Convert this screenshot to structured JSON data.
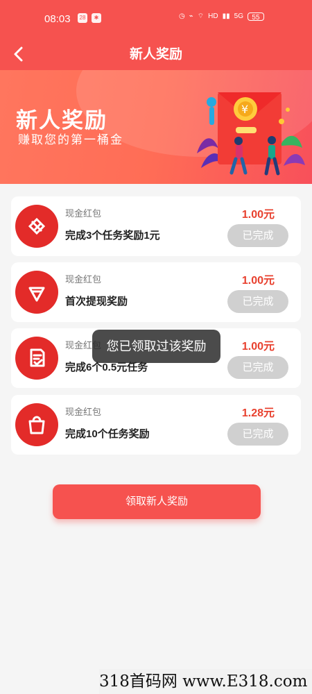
{
  "status_bar": {
    "time": "08:03",
    "left_icons": [
      "calendar-icon",
      "settings-icon"
    ],
    "calendar_text": "28",
    "right_icons": [
      "alarm-icon",
      "mute-icon",
      "wifi-icon",
      "hd-icon",
      "signal-icon",
      "5g-signal-icon"
    ],
    "hd_text": "HD",
    "battery": "55"
  },
  "header": {
    "title": "新人奖励",
    "back_icon": "back-icon"
  },
  "banner": {
    "title": "新人奖励",
    "subtitle": "赚取您的第一桶金"
  },
  "rewards": [
    {
      "category": "现金红包",
      "description": "完成3个任务奖励1元",
      "amount": "1.00元",
      "status": "已完成",
      "icon": "coupon-icon"
    },
    {
      "category": "现金红包",
      "description": "首次提现奖励",
      "amount": "1.00元",
      "status": "已完成",
      "icon": "diamond-icon"
    },
    {
      "category": "现金红包",
      "description": "完成6个0.5元任务",
      "amount": "1.00元",
      "status": "已完成",
      "icon": "document-check-icon"
    },
    {
      "category": "现金红包",
      "description": "完成10个任务奖励",
      "amount": "1.28元",
      "status": "已完成",
      "icon": "shopping-bag-icon"
    }
  ],
  "toast": {
    "text": "您已领取过该奖励"
  },
  "actions": {
    "claim_label": "领取新人奖励"
  },
  "watermark": {
    "text": "318首码网 www.E318.com"
  },
  "colors": {
    "brand_red": "#f6524f",
    "amount_red": "#e8412f",
    "completed_gray": "#d0d0d0"
  }
}
